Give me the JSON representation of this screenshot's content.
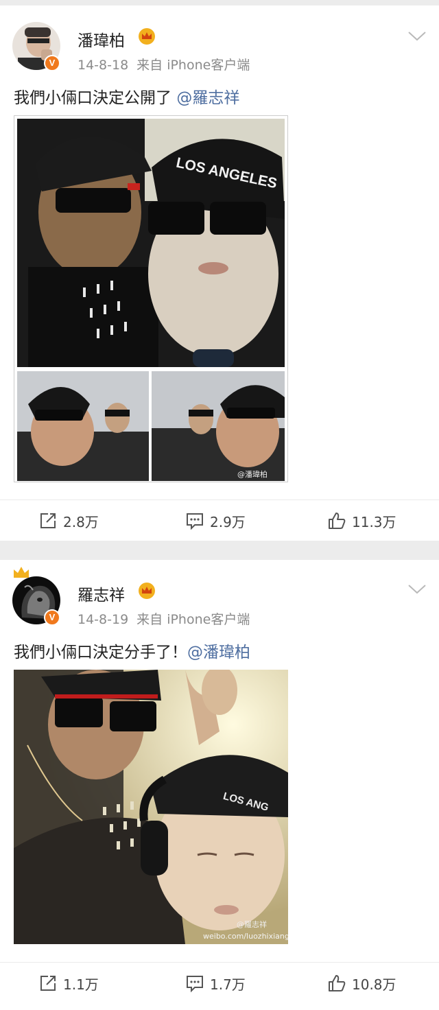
{
  "posts": [
    {
      "username": "潘瑋柏",
      "date": "14-8-18",
      "source": "来自 iPhone客户端",
      "text": "我們小倆口決定公開了 ",
      "mention": "@羅志祥",
      "photo_cap_text": "LOS ANGELES",
      "watermark": "@潘瑋柏",
      "stats": {
        "repost": "2.8万",
        "comment": "2.9万",
        "like": "11.3万"
      }
    },
    {
      "username": "羅志祥",
      "date": "14-8-19",
      "source": "来自 iPhone客户端",
      "text": "我們小倆口決定分手了！",
      "mention": "@潘瑋柏",
      "photo_cap_text": "LOS ANG",
      "watermark": "@羅志祥",
      "watermark_url": "weibo.com/luozhixiang",
      "stats": {
        "repost": "1.1万",
        "comment": "1.7万",
        "like": "10.8万"
      }
    }
  ],
  "icons": [
    "repost-icon",
    "comment-icon",
    "like-icon",
    "chevron-down-icon",
    "crown-icon",
    "verified-badge-icon"
  ],
  "colors": {
    "mention": "#4e6ea0",
    "verified": "#f0791d",
    "crown": "#f2b01e",
    "meta": "#8a8a8a"
  }
}
